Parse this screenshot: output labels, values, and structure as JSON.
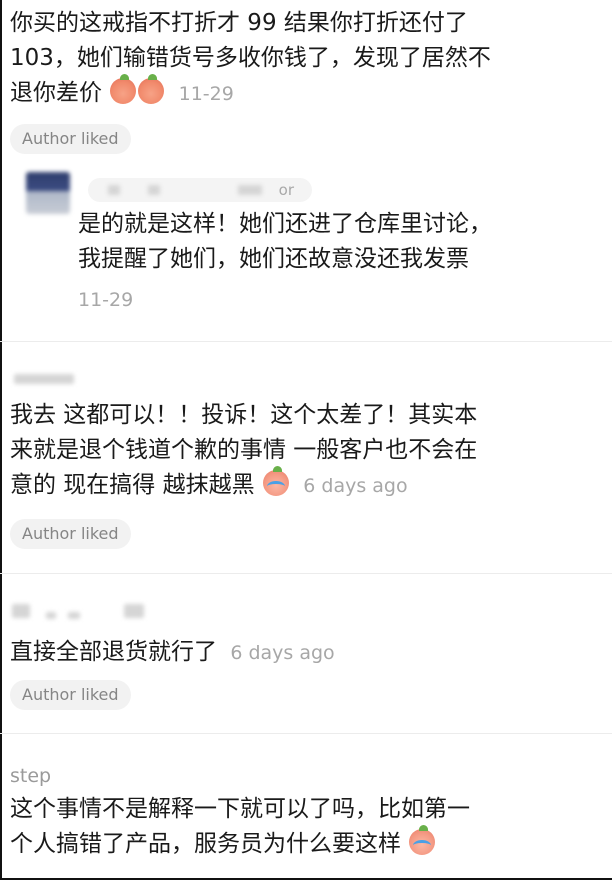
{
  "comment1": {
    "lines": [
      "你买的这戒指不打折才 99 结果你打折还付了",
      "103，她们输错货号多收你钱了，发现了居然不",
      "退你差价"
    ],
    "emojis": [
      "peach-face",
      "peach-face"
    ],
    "time": "11-29",
    "badge": "Author liked"
  },
  "reply1": {
    "name_suffix": "or",
    "lines": [
      "是的就是这样！她们还进了仓库里讨论，",
      "我提醒了她们，她们还故意没还我发票"
    ],
    "time": "11-29"
  },
  "comment2": {
    "lines": [
      "我去 这都可以！！投诉！这个太差了！其实本",
      "来就是退个钱道个歉的事情 一般客户也不会在",
      "意的 现在搞得 越抹越黑"
    ],
    "emojis": [
      "crying-peach"
    ],
    "time": "6 days ago",
    "badge": "Author liked"
  },
  "comment3": {
    "lines": [
      "直接全部退货就行了"
    ],
    "time": "6 days ago",
    "badge": "Author liked"
  },
  "comment4": {
    "username": "step",
    "lines": [
      "这个事情不是解释一下就可以了吗，比如第一",
      "个人搞错了产品，服务员为什么要这样"
    ],
    "emojis": [
      "crying-peach"
    ]
  },
  "colors": {
    "text": "#1a1a1a",
    "muted": "#a7a7a7",
    "badge_bg": "#f2f2f2",
    "badge_text": "#858585",
    "divider": "#ececec"
  }
}
